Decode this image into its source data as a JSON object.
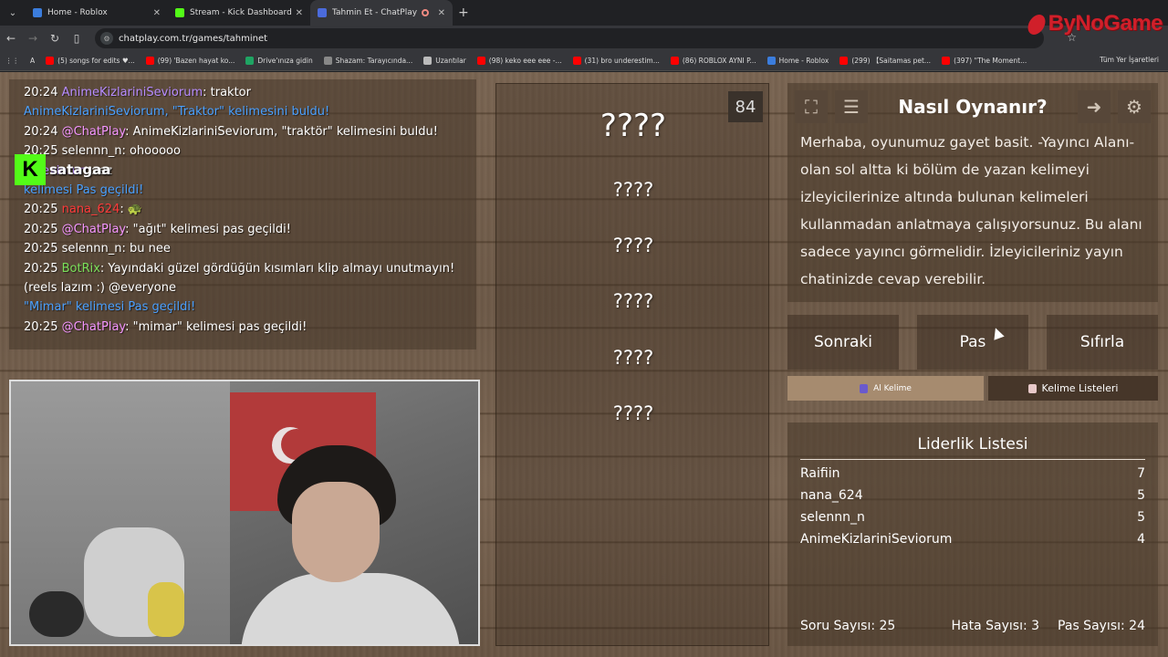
{
  "browser": {
    "tabs": [
      {
        "label": "Home - Roblox",
        "color": "#3b7ddd"
      },
      {
        "label": "Stream - Kick Dashboard",
        "color": "#53fc18"
      },
      {
        "label": "Tahmin Et - ChatPlay",
        "color": "#4b6bdc"
      }
    ],
    "url": "chatplay.com.tr/games/tahminet",
    "bookmarks": [
      {
        "label": "(5) songs for edits ♥...",
        "color": "#ff0000"
      },
      {
        "label": "(99) 'Bazen hayat ko...",
        "color": "#ff0000"
      },
      {
        "label": "Drive'ınıza gidin",
        "color": "#1fa463"
      },
      {
        "label": "Shazam: Tarayıcında...",
        "color": "#888888"
      },
      {
        "label": "Uzantılar",
        "color": "#bbbbbb"
      },
      {
        "label": "(98) keko eee eee -...",
        "color": "#ff0000"
      },
      {
        "label": "(31) bro underestim...",
        "color": "#ff0000"
      },
      {
        "label": "(86) ROBLOX AYNI P...",
        "color": "#ff0000"
      },
      {
        "label": "Home - Roblox",
        "color": "#3b7ddd"
      },
      {
        "label": "(299) 【Saitamas pet...",
        "color": "#ff0000"
      },
      {
        "label": "(397) \"The Moment...",
        "color": "#ff0000"
      }
    ],
    "all_bookmarks": "Tüm Yer İşaretleri"
  },
  "watermark": "ByNoGame",
  "kick": {
    "letter": "K",
    "name": "satagaa"
  },
  "chat": {
    "lines": [
      {
        "time": "20:24",
        "user": "AnimeKizlariniSeviorum",
        "user_class": "u-purple",
        "msg": ": traktor"
      },
      {
        "time": "",
        "user": "AnimeKizlariniSeviorum, \"Traktor\" kelimesini buldu!",
        "user_class": "u-blue",
        "msg": ""
      },
      {
        "time": "20:24",
        "user": "@ChatPlay",
        "user_class": "u-pink",
        "msg": ": AnimeKizlariniSeviorum, \"traktör\" kelimesini buldu!"
      },
      {
        "time": "20:25",
        "user": "selennn_n",
        "user_class": "",
        "msg": ": ohooooo"
      },
      {
        "time": "",
        "user": "niSeviorum",
        "user_class": "u-purple",
        "msg": ": ez"
      },
      {
        "time": "",
        "user": "kelimesi Pas geçildi!",
        "user_class": "u-blue",
        "msg": ""
      },
      {
        "time": "20:25",
        "user": "nana_624",
        "user_class": "u-red",
        "msg": ": 🐢"
      },
      {
        "time": "20:25",
        "user": "@ChatPlay",
        "user_class": "u-pink",
        "msg": ": \"ağıt\" kelimesi pas geçildi!"
      },
      {
        "time": "20:25",
        "user": "selennn_n",
        "user_class": "",
        "msg": ": bu nee"
      },
      {
        "time": "20:25",
        "user": "BotRix",
        "user_class": "u-lime",
        "msg": ": Yayındaki güzel gördüğün kısımları klip almayı unutmayın!"
      },
      {
        "time": "",
        "user": "",
        "user_class": "",
        "msg": "(reels lazım :) @everyone"
      },
      {
        "time": "",
        "user": "\"Mimar\" kelimesi Pas geçildi!",
        "user_class": "u-blue",
        "msg": ""
      },
      {
        "time": "20:25",
        "user": "@ChatPlay",
        "user_class": "u-pink",
        "msg": ": \"mimar\" kelimesi pas geçildi!"
      }
    ]
  },
  "game": {
    "counter": "84",
    "words": [
      "????",
      "????",
      "????",
      "????",
      "????",
      "????"
    ]
  },
  "howto": {
    "title": "Nasıl Oynanır?",
    "text": "Merhaba, oyunumuz gayet basit. -Yayıncı Alanı- olan sol altta ki bölüm de yazan kelimeyi izleyicilerinize altında bulunan kelimeleri kullanmadan anlatmaya çalışıyorsunuz. Bu alanı sadece yayıncı görmelidir. İzleyicileriniz yayın chatinizde cevap verebilir."
  },
  "actions": {
    "next": "Sonraki",
    "pass": "Pas",
    "reset": "Sıfırla"
  },
  "tabs": {
    "get_word": "Al Kelime",
    "word_lists": "Kelime Listeleri"
  },
  "leaderboard": {
    "title": "Liderlik Listesi",
    "rows": [
      {
        "name": "Raifiin",
        "score": "7"
      },
      {
        "name": "nana_624",
        "score": "5"
      },
      {
        "name": "selennn_n",
        "score": "5"
      },
      {
        "name": "AnimeKizlariniSeviorum",
        "score": "4"
      }
    ]
  },
  "stats": {
    "questions": "Soru Sayısı: 25",
    "errors": "Hata Sayısı: 3",
    "passes": "Pas Sayısı: 24"
  }
}
